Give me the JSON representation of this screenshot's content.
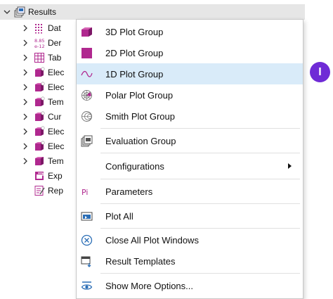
{
  "tree": {
    "root_label": "Results",
    "children": [
      {
        "label": "Dat",
        "icon": "datasets-icon"
      },
      {
        "label": "Der",
        "icon": "derived-values-icon",
        "icon_text_top": "8.85",
        "icon_text_bottom": "e-12"
      },
      {
        "label": "Tab",
        "icon": "table-icon"
      },
      {
        "label": "Elec",
        "icon": "plot-group-icon"
      },
      {
        "label": "Elec",
        "icon": "plot-group-icon"
      },
      {
        "label": "Tem",
        "icon": "plot-group-icon"
      },
      {
        "label": "Cur",
        "icon": "plot-group-icon"
      },
      {
        "label": "Elec",
        "icon": "plot-group-icon"
      },
      {
        "label": "Elec",
        "icon": "plot-group-icon"
      },
      {
        "label": "Tem",
        "icon": "plot-group-icon"
      },
      {
        "label": "Exp",
        "icon": "export-icon"
      },
      {
        "label": "Rep",
        "icon": "reports-icon"
      }
    ]
  },
  "menu": {
    "items": [
      {
        "label": "3D Plot Group",
        "icon": "3d-plot-group-icon"
      },
      {
        "label": "2D Plot Group",
        "icon": "2d-plot-group-icon"
      },
      {
        "label": "1D Plot Group",
        "icon": "1d-plot-group-icon",
        "highlighted": true
      },
      {
        "label": "Polar Plot Group",
        "icon": "polar-plot-group-icon"
      },
      {
        "label": "Smith Plot Group",
        "icon": "smith-plot-group-icon"
      },
      {
        "label": "Evaluation Group",
        "icon": "evaluation-group-icon"
      },
      {
        "label": "Configurations",
        "submenu": true
      },
      {
        "label": "Parameters",
        "icon": "parameters-icon",
        "icon_text": "Pi"
      },
      {
        "label": "Plot All",
        "icon": "plot-all-icon"
      },
      {
        "label": "Close All Plot Windows",
        "icon": "close-all-icon"
      },
      {
        "label": "Result Templates",
        "icon": "result-templates-icon"
      },
      {
        "label": "Show More Options...",
        "icon": "show-more-options-icon"
      }
    ]
  },
  "badge": {
    "text": "I"
  },
  "colors": {
    "highlight": "#d9ebf9",
    "accent": "#b0288f",
    "badge": "#6f2bd6",
    "icon_blue": "#2a6db5"
  }
}
